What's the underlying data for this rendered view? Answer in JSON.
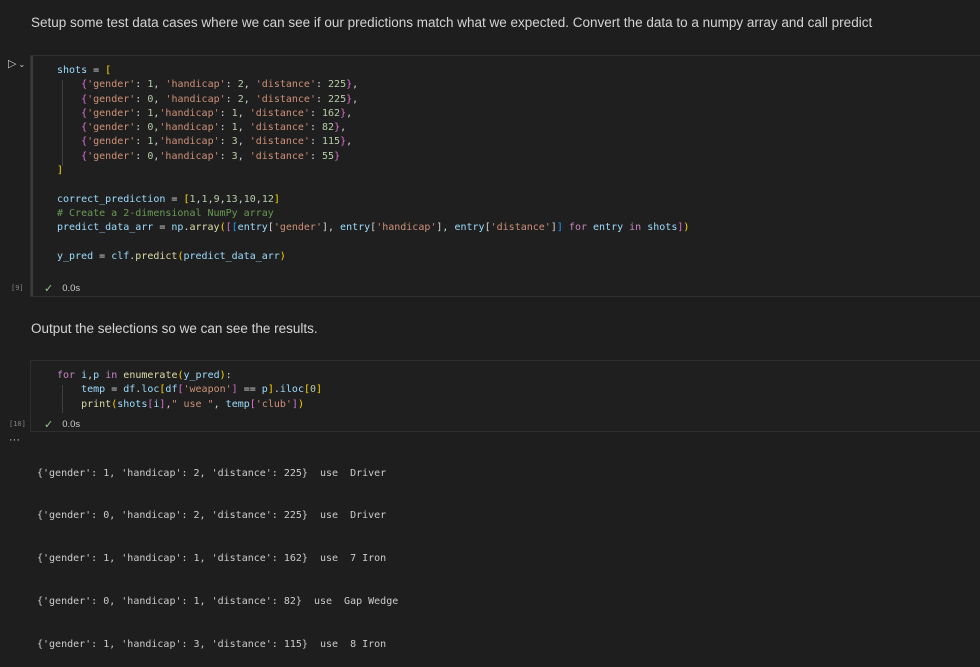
{
  "markdown1": "Setup some test data cases where we can see if our predictions match what we expected. Convert the data to a numpy array and call predict",
  "markdown2": "Output the selections so we can see the results.",
  "cell1": {
    "exec_count": "[9]",
    "status_time": "0.0s",
    "lines": [
      "shots = [",
      "    {'gender': 1, 'handicap': 2, 'distance': 225},",
      "    {'gender': 0, 'handicap': 2, 'distance': 225},",
      "    {'gender': 1,'handicap': 1, 'distance': 162},",
      "    {'gender': 0,'handicap': 1, 'distance': 82},",
      "    {'gender': 1,'handicap': 3, 'distance': 115},",
      "    {'gender': 0,'handicap': 3, 'distance': 55}",
      "]",
      "",
      "correct_prediction = [1,1,9,13,10,12]",
      "# Create a 2-dimensional NumPy array",
      "predict_data_arr = np.array([[entry['gender'], entry['handicap'], entry['distance']] for entry in shots])",
      "",
      "y_pred = clf.predict(predict_data_arr)"
    ]
  },
  "cell2": {
    "exec_count": "[10]",
    "status_time": "0.0s",
    "lines": [
      "for i,p in enumerate(y_pred):",
      "    temp = df.loc[df['weapon'] == p].iloc[0]",
      "    print(shots[i],\" use \", temp['club'])"
    ]
  },
  "output": {
    "more_label": "···",
    "lines": [
      "{'gender': 1, 'handicap': 2, 'distance': 225}  use  Driver",
      "{'gender': 0, 'handicap': 2, 'distance': 225}  use  Driver",
      "{'gender': 1, 'handicap': 1, 'distance': 162}  use  7 Iron",
      "{'gender': 0, 'handicap': 1, 'distance': 82}  use  Gap Wedge",
      "{'gender': 1, 'handicap': 3, 'distance': 115}  use  8 Iron"
    ]
  },
  "icons": {
    "run": "run-icon",
    "expand": "chevron-down-icon",
    "success": "check-icon"
  },
  "colors": {
    "background": "#1e1e1e",
    "success": "#89d185",
    "keyword": "#569cd6",
    "string": "#ce9178"
  }
}
